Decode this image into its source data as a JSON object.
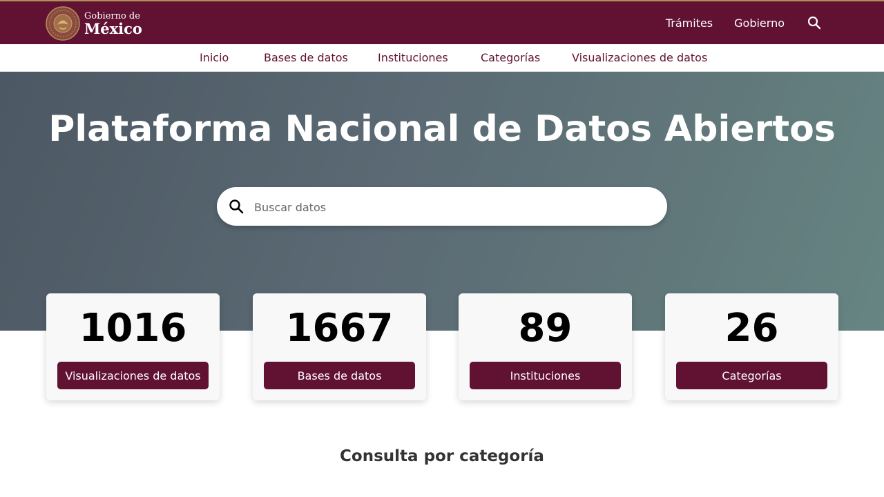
{
  "header": {
    "logo_line1": "Gobierno de",
    "logo_line2": "México",
    "links": [
      "Trámites",
      "Gobierno"
    ],
    "search_icon": "search-icon"
  },
  "subnav": {
    "items": [
      "Inicio",
      "Bases de datos",
      "Instituciones",
      "Categorías",
      "Visualizaciones de datos"
    ]
  },
  "hero": {
    "title": "Plataforma Nacional de Datos Abiertos",
    "search_placeholder": "Buscar datos"
  },
  "stats": [
    {
      "value": "1016",
      "label": "Visualizaciones de datos"
    },
    {
      "value": "1667",
      "label": "Bases de datos"
    },
    {
      "value": "89",
      "label": "Instituciones"
    },
    {
      "value": "26",
      "label": "Categorías"
    }
  ],
  "section": {
    "title": "Consulta por categoría"
  },
  "colors": {
    "brand": "#611232",
    "accent": "#b38e5d"
  }
}
